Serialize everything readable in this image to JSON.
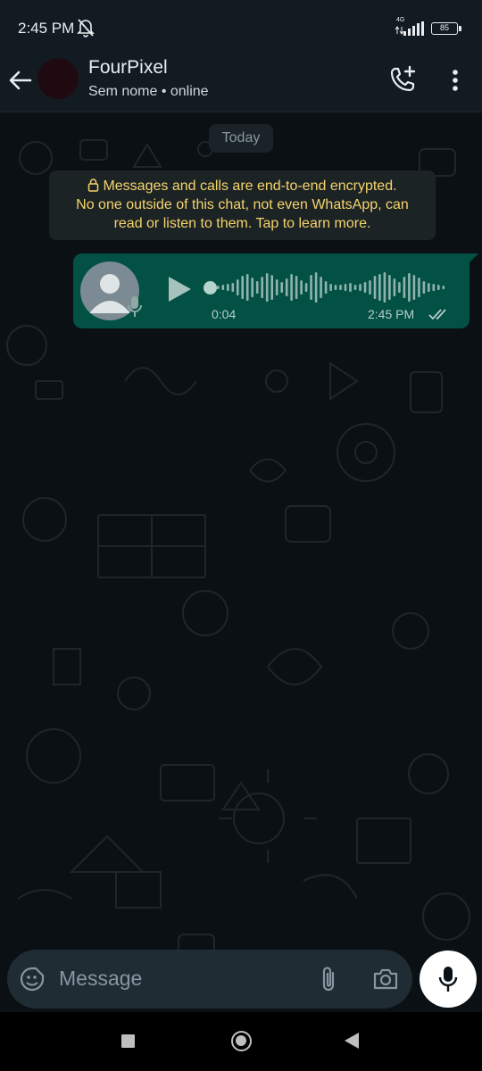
{
  "status_bar": {
    "time": "2:45 PM",
    "network": "4G",
    "battery": "85",
    "icons": [
      "bell-off-icon",
      "signal-icon",
      "battery-icon"
    ]
  },
  "header": {
    "contact_name": "FourPixel",
    "contact_status": "Sem nome • online",
    "icons": [
      "back-arrow-icon",
      "add-call-icon",
      "more-vertical-icon"
    ]
  },
  "chat": {
    "date_chip": "Today",
    "encryption_notice": {
      "line1": "Messages and calls are end-to-end encrypted.",
      "line2": "No one outside of this chat, not even WhatsApp, can",
      "line3": "read or listen to them. Tap to learn more."
    },
    "voice_message": {
      "duration": "0:04",
      "time": "2:45 PM",
      "status": "read",
      "progress": 0
    }
  },
  "composer": {
    "placeholder": "Message",
    "icons": [
      "sticker-icon",
      "attach-icon",
      "camera-icon",
      "mic-icon"
    ]
  },
  "colors": {
    "header_bg": "#121b22",
    "chat_bg": "#0b1014",
    "outgoing_bubble": "#025144",
    "encryption_text": "#f5d46b",
    "composer_bg": "#1f2c34"
  }
}
